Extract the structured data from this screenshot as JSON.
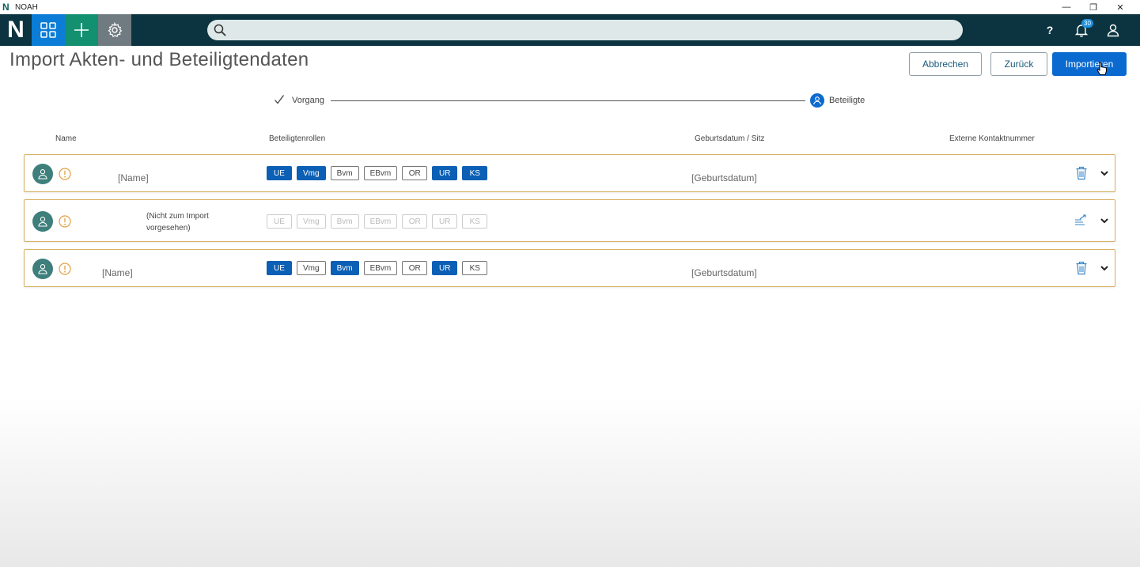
{
  "window": {
    "title": "NOAH",
    "minimize": "—",
    "restore": "❐",
    "close": "✕"
  },
  "appbar": {
    "brand": "N",
    "search_placeholder": "",
    "help": "?",
    "notifications_count": "30"
  },
  "page": {
    "title": "Import Akten- und Beteiligtendaten",
    "buttons": {
      "cancel": "Abbrechen",
      "back": "Zurück",
      "import": "Importieren"
    }
  },
  "stepper": {
    "steps": [
      {
        "label": "Vorgang",
        "state": "done"
      },
      {
        "label": "Beteiligte",
        "state": "active"
      }
    ]
  },
  "table": {
    "headers": {
      "name": "Name",
      "roles": "Beteiligtenrollen",
      "birth": "Geburtsdatum / Sitz",
      "external": "Externe Kontaktnummer"
    },
    "rows": [
      {
        "name": "[Name]",
        "birth": "[Geburtsdatum]",
        "action_icon": "trash-icon",
        "roles": [
          {
            "label": "UE",
            "state": "on"
          },
          {
            "label": "Vmg",
            "state": "on"
          },
          {
            "label": "Bvm",
            "state": "off"
          },
          {
            "label": "EBvm",
            "state": "off"
          },
          {
            "label": "OR",
            "state": "off"
          },
          {
            "label": "UR",
            "state": "on"
          },
          {
            "label": "KS",
            "state": "on"
          }
        ]
      },
      {
        "name": "(Nicht zum Import vorgesehen)",
        "birth": "",
        "action_icon": "swap-icon",
        "roles": [
          {
            "label": "UE",
            "state": "disabled"
          },
          {
            "label": "Vmg",
            "state": "disabled"
          },
          {
            "label": "Bvm",
            "state": "disabled"
          },
          {
            "label": "EBvm",
            "state": "disabled"
          },
          {
            "label": "OR",
            "state": "disabled"
          },
          {
            "label": "UR",
            "state": "disabled"
          },
          {
            "label": "KS",
            "state": "disabled"
          }
        ]
      },
      {
        "name": "[Name]",
        "birth": "[Geburtsdatum]",
        "action_icon": "trash-icon",
        "roles": [
          {
            "label": "UE",
            "state": "on"
          },
          {
            "label": "Vmg",
            "state": "off"
          },
          {
            "label": "Bvm",
            "state": "on"
          },
          {
            "label": "EBvm",
            "state": "off"
          },
          {
            "label": "OR",
            "state": "off"
          },
          {
            "label": "UR",
            "state": "on"
          },
          {
            "label": "KS",
            "state": "off"
          }
        ]
      }
    ]
  },
  "colors": {
    "appbar": "#0c3440",
    "primary": "#0b6ad0",
    "role_active": "#0b5fb5",
    "row_border": "#d7b065",
    "avatar": "#3e7f7c",
    "warning": "#e0a040"
  }
}
